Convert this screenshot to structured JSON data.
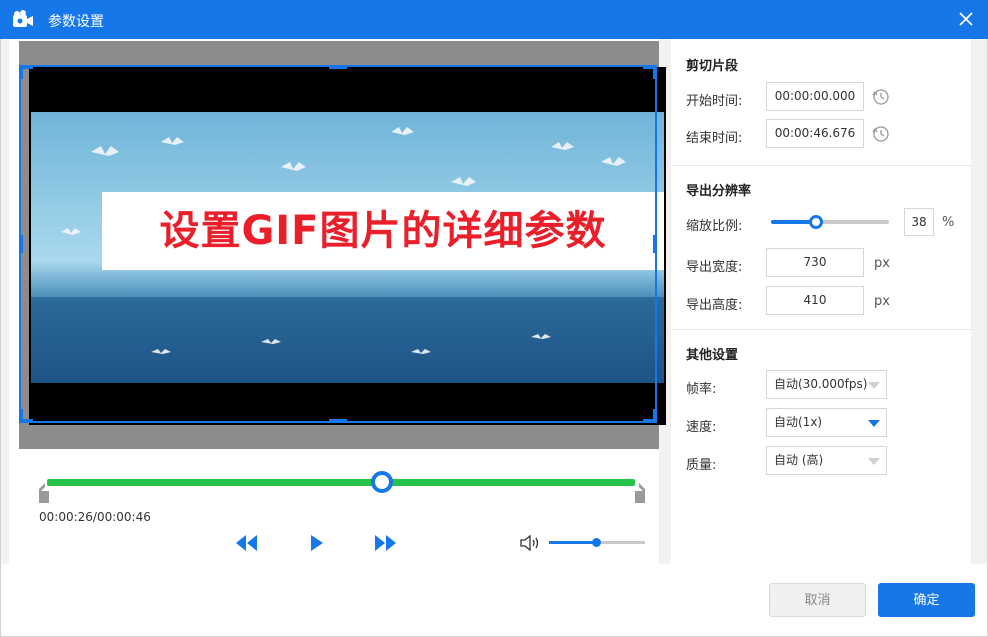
{
  "window": {
    "title": "参数设置"
  },
  "preview": {
    "overlay_text": "设置GIF图片的详细参数"
  },
  "timeline": {
    "current_time": "00:00:26/00:00:46",
    "progress": 0.57
  },
  "volume": {
    "level": 0.49
  },
  "clip": {
    "section_title": "剪切片段",
    "start_label": "开始时间:",
    "start_value": "00:00:00.000",
    "end_label": "结束时间:",
    "end_value": "00:00:46.676"
  },
  "resolution": {
    "section_title": "导出分辨率",
    "scale_label": "缩放比例:",
    "scale_value": "38",
    "scale_unit": "%",
    "width_label": "导出宽度:",
    "width_value": "730",
    "height_label": "导出高度:",
    "height_value": "410",
    "unit": "px"
  },
  "other": {
    "section_title": "其他设置",
    "framerate_label": "帧率:",
    "framerate_value": "自动(30.000fps)",
    "speed_label": "速度:",
    "speed_value": "自动(1x)",
    "quality_label": "质量:",
    "quality_value": "自动 (高)"
  },
  "footer": {
    "cancel_label": "取消",
    "ok_label": "确定"
  },
  "colors": {
    "accent": "#1677e8",
    "track": "#27c24c",
    "overlay_text": "#ea1f2a"
  }
}
